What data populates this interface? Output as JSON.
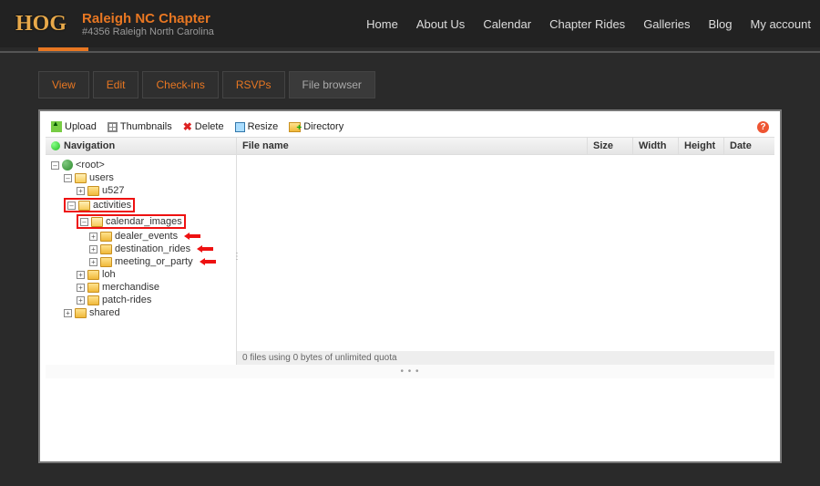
{
  "header": {
    "logo_text": "HOG",
    "chapter_name": "Raleigh NC Chapter",
    "chapter_sub": "#4356 Raleigh North Carolina",
    "nav": [
      "Home",
      "About Us",
      "Calendar",
      "Chapter Rides",
      "Galleries",
      "Blog",
      "My account"
    ]
  },
  "tabs": [
    {
      "label": "View",
      "active": false
    },
    {
      "label": "Edit",
      "active": false
    },
    {
      "label": "Check-ins",
      "active": false
    },
    {
      "label": "RSVPs",
      "active": false
    },
    {
      "label": "File browser",
      "active": true
    }
  ],
  "toolbar": {
    "upload": "Upload",
    "thumbnails": "Thumbnails",
    "delete": "Delete",
    "resize": "Resize",
    "directory": "Directory",
    "help": "?"
  },
  "nav_panel": {
    "title": "Navigation",
    "tree": {
      "root": "<root>",
      "users": "users",
      "u527": "u527",
      "activities": "activities",
      "calendar_images": "calendar_images",
      "dealer_events": "dealer_events",
      "destination_rides": "destination_rides",
      "meeting_or_party": "meeting_or_party",
      "loh": "loh",
      "merchandise": "merchandise",
      "patch_rides": "patch-rides",
      "shared": "shared"
    }
  },
  "list": {
    "cols": {
      "name": "File name",
      "size": "Size",
      "width": "Width",
      "height": "Height",
      "date": "Date"
    },
    "status": "0 files using 0 bytes of unlimited quota"
  }
}
